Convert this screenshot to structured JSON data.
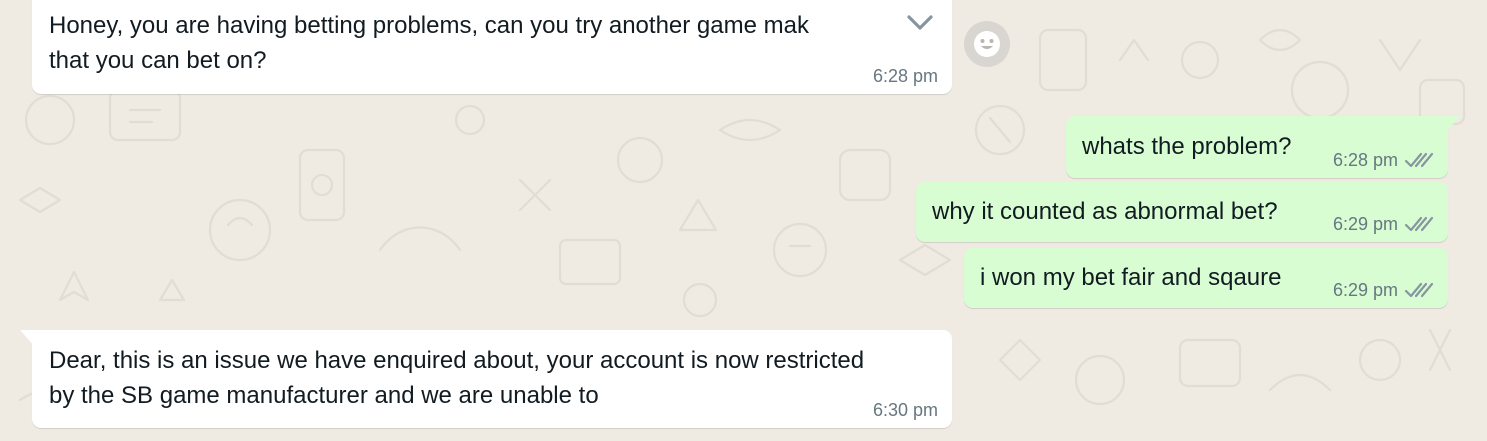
{
  "chat": {
    "messages": [
      {
        "direction": "incoming",
        "lines": [
          "Honey, you are having betting problems, can you try another game mak",
          "that you can bet on?"
        ],
        "time": "6:28 pm"
      },
      {
        "direction": "outgoing",
        "lines": [
          "whats the problem?"
        ],
        "time": "6:28 pm",
        "status": "read"
      },
      {
        "direction": "outgoing",
        "lines": [
          "why it counted as abnormal bet?"
        ],
        "time": "6:29 pm",
        "status": "read"
      },
      {
        "direction": "outgoing",
        "lines": [
          "i won my bet fair and sqaure"
        ],
        "time": "6:29 pm",
        "status": "read"
      },
      {
        "direction": "incoming",
        "lines": [
          "Dear, this is an issue we have enquired about, your account is now restricted",
          "by the SB game manufacturer and we are unable to"
        ],
        "time": "6:30 pm"
      }
    ]
  },
  "icons": {
    "message_menu": "chevron-down-icon",
    "reaction": "smiley-icon",
    "read_receipt": "double-check-icon"
  },
  "colors": {
    "background": "#efeae2",
    "incoming_bubble": "#ffffff",
    "outgoing_bubble": "#d9fdd3",
    "meta_text": "#667781",
    "ticks": "#8696a0"
  }
}
